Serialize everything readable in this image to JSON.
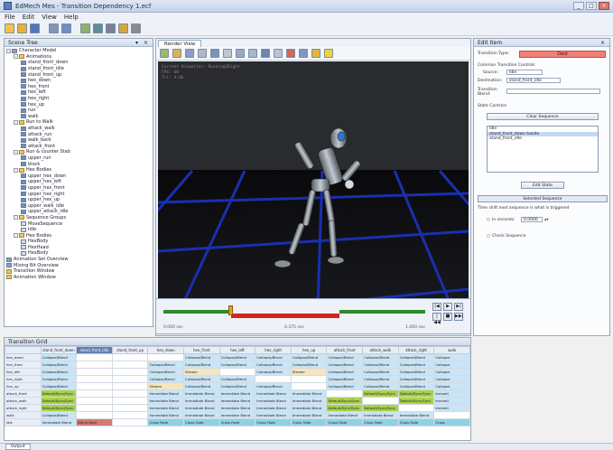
{
  "window": {
    "title": "EdMech Mes - Transition Dependency 1.ecf",
    "buttons": [
      "_",
      "□",
      "×"
    ]
  },
  "menu": [
    "File",
    "Edit",
    "View",
    "Help"
  ],
  "left_panel": {
    "title": "Scene Tree",
    "tree": [
      {
        "depth": 0,
        "icon": "model",
        "exp": "-",
        "label": "Character Model"
      },
      {
        "depth": 1,
        "icon": "folder",
        "exp": "-",
        "label": "Animations"
      },
      {
        "depth": 2,
        "icon": "anim",
        "exp": "",
        "label": "stand_front_down"
      },
      {
        "depth": 2,
        "icon": "anim",
        "exp": "",
        "label": "stand_front_idle"
      },
      {
        "depth": 2,
        "icon": "anim",
        "exp": "",
        "label": "stand_front_up"
      },
      {
        "depth": 2,
        "icon": "anim",
        "exp": "",
        "label": "hex_down"
      },
      {
        "depth": 2,
        "icon": "anim",
        "exp": "",
        "label": "hex_front"
      },
      {
        "depth": 2,
        "icon": "anim",
        "exp": "",
        "label": "hex_left"
      },
      {
        "depth": 2,
        "icon": "anim",
        "exp": "",
        "label": "hex_right"
      },
      {
        "depth": 2,
        "icon": "anim",
        "exp": "",
        "label": "hex_up"
      },
      {
        "depth": 2,
        "icon": "anim",
        "exp": "",
        "label": "run"
      },
      {
        "depth": 2,
        "icon": "anim",
        "exp": "",
        "label": "walk"
      },
      {
        "depth": 1,
        "icon": "folder",
        "exp": "-",
        "label": "Run to Walk"
      },
      {
        "depth": 2,
        "icon": "anim",
        "exp": "",
        "label": "attack_walk"
      },
      {
        "depth": 2,
        "icon": "anim",
        "exp": "",
        "label": "attack_run"
      },
      {
        "depth": 2,
        "icon": "anim",
        "exp": "",
        "label": "walk_back"
      },
      {
        "depth": 2,
        "icon": "anim",
        "exp": "",
        "label": "attack_front"
      },
      {
        "depth": 1,
        "icon": "folder",
        "exp": "-",
        "label": "Run & counter Stab"
      },
      {
        "depth": 2,
        "icon": "anim",
        "exp": "",
        "label": "upper_run"
      },
      {
        "depth": 2,
        "icon": "anim",
        "exp": "",
        "label": "block"
      },
      {
        "depth": 1,
        "icon": "folder",
        "exp": "-",
        "label": "Hex Bodies"
      },
      {
        "depth": 2,
        "icon": "anim",
        "exp": "",
        "label": "upper_hex_down"
      },
      {
        "depth": 2,
        "icon": "anim",
        "exp": "",
        "label": "upper_hex_left"
      },
      {
        "depth": 2,
        "icon": "anim",
        "exp": "",
        "label": "upper_hex_front"
      },
      {
        "depth": 2,
        "icon": "anim",
        "exp": "",
        "label": "upper_hex_right"
      },
      {
        "depth": 2,
        "icon": "anim",
        "exp": "",
        "label": "upper_hex_up"
      },
      {
        "depth": 2,
        "icon": "anim",
        "exp": "",
        "label": "upper_walk_idle"
      },
      {
        "depth": 2,
        "icon": "anim",
        "exp": "",
        "label": "upper_attack_idle"
      },
      {
        "depth": 1,
        "icon": "folder",
        "exp": "-",
        "label": "Sequence Groups"
      },
      {
        "depth": 2,
        "icon": "state",
        "exp": "",
        "label": "MoveSequence"
      },
      {
        "depth": 2,
        "icon": "state",
        "exp": "",
        "label": "Idle"
      },
      {
        "depth": 1,
        "icon": "folder",
        "exp": "-",
        "label": "Hex Bodies"
      },
      {
        "depth": 2,
        "icon": "state",
        "exp": "",
        "label": "HexBody"
      },
      {
        "depth": 2,
        "icon": "state",
        "exp": "",
        "label": "HexHead"
      },
      {
        "depth": 2,
        "icon": "state",
        "exp": "",
        "label": "HexBody"
      },
      {
        "depth": 0,
        "icon": "model",
        "exp": "",
        "label": "Animation Set Overview"
      },
      {
        "depth": 0,
        "icon": "model",
        "exp": "",
        "label": "Mixing Bit Overview"
      },
      {
        "depth": 0,
        "icon": "folder",
        "exp": "",
        "label": "Transition Window"
      },
      {
        "depth": 0,
        "icon": "folder",
        "exp": "",
        "label": "Animation Window"
      }
    ]
  },
  "viewport": {
    "tab_label": "Render View",
    "overlay": [
      "Current Animation: Running1Right",
      "FPS: 60",
      "Tri: 4.6k"
    ]
  },
  "timeline": {
    "labels": [
      "0.000 sec",
      "0.375 sec",
      "1.000 sec"
    ],
    "transport": [
      "|◀",
      "▶",
      "▶|",
      "|◀◀",
      "■",
      "▶▶|"
    ]
  },
  "right_panel": {
    "title": "Edit Item",
    "transition_type_label": "Transition Type:",
    "transition_type_value": "Dest",
    "section_label": "Common Transition Controls",
    "source_label": "Source:",
    "source_value": "Idle",
    "destination_label": "Destination:",
    "destination_value": "stand_front_idle",
    "blend_label": "Transition Blend:",
    "state_controls_label": "State Controls",
    "clear_button": "Clear Sequence",
    "list_items": [
      "Idle",
      "stand_front_down toside",
      "stand_front_idle"
    ],
    "edit_button": "Edit State",
    "selected_bar": "Selected Sequence",
    "hint": "Time shift next sequence is what is triggered",
    "seconds_label": "In seconds:",
    "seconds_value": "0.0000",
    "check_label": "Check Sequence"
  },
  "bottom_panel": {
    "title": "Transition Grid",
    "tabs": [
      "base0",
      "base"
    ],
    "columns": [
      "",
      "stand_front_down",
      "stand_front_idle",
      "stand_front_up",
      "hex_down",
      "hex_front",
      "hex_left",
      "hex_right",
      "hex_up",
      "attack_front",
      "attack_walk",
      "attack_right",
      "walk"
    ],
    "selected_column": 2,
    "rows": [
      {
        "h": "hex_down",
        "c": [
          [
            "Collapse/Blend",
            "blue"
          ],
          [
            "",
            ""
          ],
          [
            "",
            ""
          ],
          [
            "",
            ""
          ],
          [
            "Collapse/Blend",
            "blue"
          ],
          [
            "Collapse/Blend",
            "blue"
          ],
          [
            "Collapse/Blend",
            "blue"
          ],
          [
            "Collapse/Blend",
            "blue"
          ],
          [
            "Collapse/Blend",
            "blue"
          ],
          [
            "Collapse/Blend",
            "blue"
          ],
          [
            "Collapse/Blend",
            "blue"
          ],
          [
            "Collapse",
            "blue"
          ]
        ]
      },
      {
        "h": "hex_front",
        "c": [
          [
            "Collapse/Blend",
            "blue"
          ],
          [
            "",
            ""
          ],
          [
            "",
            ""
          ],
          [
            "Collapse/Blend",
            "blue"
          ],
          [
            "Collapse/Blend",
            "blue"
          ],
          [
            "Collapse/Blend",
            "blue"
          ],
          [
            "Collapse/Blend",
            "blue"
          ],
          [
            "Collapse/Blend",
            "blue"
          ],
          [
            "Collapse/Blend",
            "blue"
          ],
          [
            "Collapse/Blend",
            "blue"
          ],
          [
            "Collapse/Blend",
            "blue"
          ],
          [
            "Collapse",
            "blue"
          ]
        ]
      },
      {
        "h": "hex_left",
        "c": [
          [
            "Collapse/Blend",
            "blue"
          ],
          [
            "",
            ""
          ],
          [
            "",
            ""
          ],
          [
            "Collapse/Blend",
            "blue"
          ],
          [
            "Stream",
            "sand"
          ],
          [
            "",
            ""
          ],
          [
            "Collapse/Blend",
            "blue"
          ],
          [
            "Stream",
            "sand"
          ],
          [
            "Collapse/Blend",
            "blue"
          ],
          [
            "Collapse/Blend",
            "blue"
          ],
          [
            "Collapse/Blend",
            "blue"
          ],
          [
            "Collapse",
            "blue"
          ]
        ]
      },
      {
        "h": "hex_right",
        "c": [
          [
            "Collapse/Blend",
            "blue"
          ],
          [
            "",
            ""
          ],
          [
            "",
            ""
          ],
          [
            "Collapse/Blend",
            "blue"
          ],
          [
            "Collapse/Blend",
            "blue"
          ],
          [
            "Collapse/Blend",
            "blue"
          ],
          [
            "",
            ""
          ],
          [
            "",
            ""
          ],
          [
            "Collapse/Blend",
            "blue"
          ],
          [
            "Collapse/Blend",
            "blue"
          ],
          [
            "Collapse/Blend",
            "blue"
          ],
          [
            "Collapse",
            "blue"
          ]
        ]
      },
      {
        "h": "hex_up",
        "c": [
          [
            "Collapse/Blend",
            "blue"
          ],
          [
            "",
            ""
          ],
          [
            "",
            ""
          ],
          [
            "Stream",
            "sand"
          ],
          [
            "Collapse/Blend",
            "blue"
          ],
          [
            "Collapse/Blend",
            "blue"
          ],
          [
            "Collapse/Blend",
            "blue"
          ],
          [
            "",
            ""
          ],
          [
            "Collapse/Blend",
            "blue"
          ],
          [
            "Collapse/Blend",
            "blue"
          ],
          [
            "Collapse/Blend",
            "blue"
          ],
          [
            "Collapse",
            "blue"
          ]
        ]
      },
      {
        "h": "attack_front",
        "c": [
          [
            "Default/Sync/Sync",
            "lime"
          ],
          [
            "",
            ""
          ],
          [
            "",
            ""
          ],
          [
            "Immediate Blend",
            "blue"
          ],
          [
            "Immediate Blend",
            "blue"
          ],
          [
            "Immediate Blend",
            "blue"
          ],
          [
            "Immediate Blend",
            "blue"
          ],
          [
            "Immediate Blend",
            "blue"
          ],
          [
            "",
            ""
          ],
          [
            "Default/Sync/Sync",
            "lime"
          ],
          [
            "Default/Sync/Sync",
            "lime"
          ],
          [
            "Immedi",
            "blue"
          ]
        ]
      },
      {
        "h": "attack_walk",
        "c": [
          [
            "Default/Sync/Sync",
            "lime"
          ],
          [
            "",
            ""
          ],
          [
            "",
            ""
          ],
          [
            "Immediate Blend",
            "blue"
          ],
          [
            "Immediate Blend",
            "blue"
          ],
          [
            "Immediate Blend",
            "blue"
          ],
          [
            "Immediate Blend",
            "blue"
          ],
          [
            "Immediate Blend",
            "blue"
          ],
          [
            "Default/Sync/Sync",
            "lime"
          ],
          [
            "",
            ""
          ],
          [
            "Default/Sync/Sync",
            "lime"
          ],
          [
            "Immedi",
            "blue"
          ]
        ]
      },
      {
        "h": "attack_right",
        "c": [
          [
            "Default/Sync/Sync",
            "lime"
          ],
          [
            "",
            ""
          ],
          [
            "",
            ""
          ],
          [
            "Immediate Blend",
            "blue"
          ],
          [
            "Immediate Blend",
            "blue"
          ],
          [
            "Immediate Blend",
            "blue"
          ],
          [
            "Immediate Blend",
            "blue"
          ],
          [
            "Immediate Blend",
            "blue"
          ],
          [
            "Default/Sync/Sync",
            "lime"
          ],
          [
            "Default/Sync/Sync",
            "lime"
          ],
          [
            "",
            ""
          ],
          [
            "Immedi",
            "blue"
          ]
        ]
      },
      {
        "h": "walk",
        "c": [
          [
            "Collapse/Blend",
            "blue"
          ],
          [
            "",
            ""
          ],
          [
            "",
            ""
          ],
          [
            "Immediate Blend",
            "blue"
          ],
          [
            "Immediate Blend",
            "blue"
          ],
          [
            "Immediate Blend",
            "blue"
          ],
          [
            "Immediate Blend",
            "blue"
          ],
          [
            "Immediate Blend",
            "blue"
          ],
          [
            "Immediate Blend",
            "blue"
          ],
          [
            "Immediate Blend",
            "blue"
          ],
          [
            "Immediate Blend",
            "blue"
          ],
          [
            "",
            ""
          ]
        ]
      },
      {
        "h": "idle",
        "c": [
          [
            "Immediate Blend",
            "blue"
          ],
          [
            "Blend Dest",
            "red"
          ],
          [
            "",
            ""
          ],
          [
            "Cross Fade",
            "teal"
          ],
          [
            "Cross Fade",
            "teal"
          ],
          [
            "Cross Fade",
            "teal"
          ],
          [
            "Cross Fade",
            "teal"
          ],
          [
            "Cross Fade",
            "teal"
          ],
          [
            "Cross Fade",
            "teal"
          ],
          [
            "Cross Fade",
            "teal"
          ],
          [
            "Cross Fade",
            "teal"
          ],
          [
            "Cross",
            "teal"
          ]
        ]
      }
    ]
  },
  "status": {
    "tab_label": "Output"
  },
  "colors": {
    "accent": "#5f7fb0",
    "dest_red": "#f08078",
    "grid_blue": "#c9e5f6",
    "grid_lime": "#a9d24a"
  }
}
